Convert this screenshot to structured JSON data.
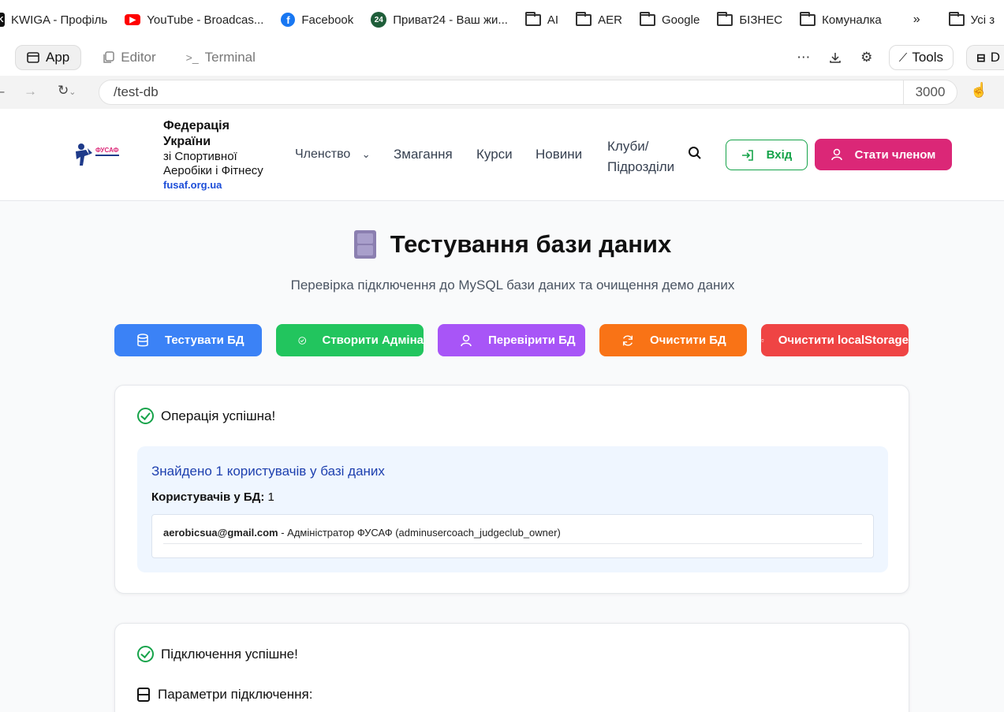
{
  "bookmarks": [
    {
      "label": "KWIGA - Профіль",
      "icon": "kwiga-icon",
      "color": "#111111"
    },
    {
      "label": "YouTube - Broadcas...",
      "icon": "youtube-icon",
      "color": "#ff0000"
    },
    {
      "label": "Facebook",
      "icon": "facebook-icon",
      "color": "#1877f2"
    },
    {
      "label": "Приват24 - Ваш жи...",
      "icon": "privat24-icon",
      "color": "#1f5e3a"
    },
    {
      "label": "AI",
      "icon": "folder-icon"
    },
    {
      "label": "AER",
      "icon": "folder-icon"
    },
    {
      "label": "Google",
      "icon": "folder-icon"
    },
    {
      "label": "БІЗНЕС",
      "icon": "folder-icon"
    },
    {
      "label": "Комуналка",
      "icon": "folder-icon"
    }
  ],
  "bookmarks_more": "»",
  "bookmarks_all": "Усі з",
  "toolbar": {
    "tabs": [
      "App",
      "Editor",
      "Terminal"
    ],
    "tools_label": "Tools",
    "d_label": "D"
  },
  "address": {
    "url": "/test-db",
    "port": "3000"
  },
  "site": {
    "brand_line1": "Федерація",
    "brand_line2": "України",
    "brand_line3": "зі Спортивної",
    "brand_line4": "Аеробіки і Фітнесу",
    "brand_site": "fusaf.org.ua",
    "logo_text": "ФУСАФ",
    "nav": [
      "Членство",
      "Змагання",
      "Курси",
      "Новини",
      "Клуби/",
      "Підрозділи"
    ],
    "login_label": "Вхід",
    "join_label": "Стати членом"
  },
  "page": {
    "title": "Тестування бази даних",
    "subtitle": "Перевірка підключення до MySQL бази даних та очищення демо даних"
  },
  "actions": [
    {
      "label": "Тестувати БД",
      "icon": "database-icon",
      "color": "#3b82f6"
    },
    {
      "label": "Створити Адміна",
      "icon": "check-circle-icon",
      "color": "#22c55e"
    },
    {
      "label": "Перевірити БД",
      "icon": "user-icon",
      "color": "#a855f7"
    },
    {
      "label": "Очистити БД",
      "icon": "refresh-icon",
      "color": "#f97316"
    },
    {
      "label": "Очистити localStorage",
      "icon": "trash-icon",
      "color": "#ef4444"
    }
  ],
  "result1": {
    "status": "Операція успішна!",
    "found": "Знайдено 1 користувачів у базі даних",
    "count_label": "Користувачів у БД:",
    "count_value": "1",
    "user_email": "aerobicsua@gmail.com",
    "user_desc": " - Адміністратор ФУСАФ (adminusercoach_judgeclub_owner)"
  },
  "result2": {
    "status": "Підключення успішне!",
    "params_label": "Параметри підключення:"
  }
}
